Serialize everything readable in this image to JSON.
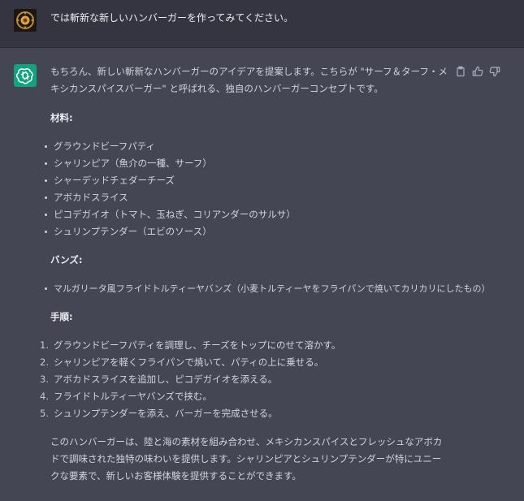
{
  "user": {
    "message": "では斬新な新しいハンバーガーを作ってみてください。"
  },
  "assistant": {
    "intro": "もちろん、新しい斬新なハンバーガーのアイデアを提案します。こちらが \"サーフ＆ターフ・メキシカンスパイスバーガー\" と呼ばれる、独自のハンバーガーコンセプトです。",
    "ingredients_heading": "材料:",
    "ingredients": [
      "グラウンドビーフパティ",
      "シャリンピア（魚介の一種、サーフ）",
      "シャーデッドチェダーチーズ",
      "アボカドスライス",
      "ピコデガイオ（トマト、玉ねぎ、コリアンダーのサルサ）",
      "シュリンプテンダー（エビのソース）"
    ],
    "buns_heading": "バンズ:",
    "buns": [
      "マルガリータ風フライドトルティーヤバンズ（小麦トルティーヤをフライパンで焼いてカリカリにしたもの）"
    ],
    "steps_heading": "手順:",
    "steps": [
      "グラウンドビーフパティを調理し、チーズをトップにのせて溶かす。",
      "シャリンピアを軽くフライパンで焼いて、パティの上に乗せる。",
      "アボカドスライスを追加し、ピコデガイオを添える。",
      "フライドトルティーヤバンズで挟む。",
      "シュリンプテンダーを添え、バーガーを完成させる。"
    ],
    "outro": "このハンバーガーは、陸と海の素材を組み合わせ、メキシカンスパイスとフレッシュなアボカドで調味された独特の味わいを提供します。シャリンピアとシュリンプテンダーが特にユニークな要素で、新しいお客様体験を提供することができます。"
  },
  "icons": {
    "copy": "clipboard-icon",
    "like": "thumbs-up-icon",
    "dislike": "thumbs-down-icon",
    "bot": "openai-logo-icon"
  },
  "colors": {
    "user_bg": "#343541",
    "assistant_bg": "#444654",
    "bot_avatar": "#10a37f"
  }
}
